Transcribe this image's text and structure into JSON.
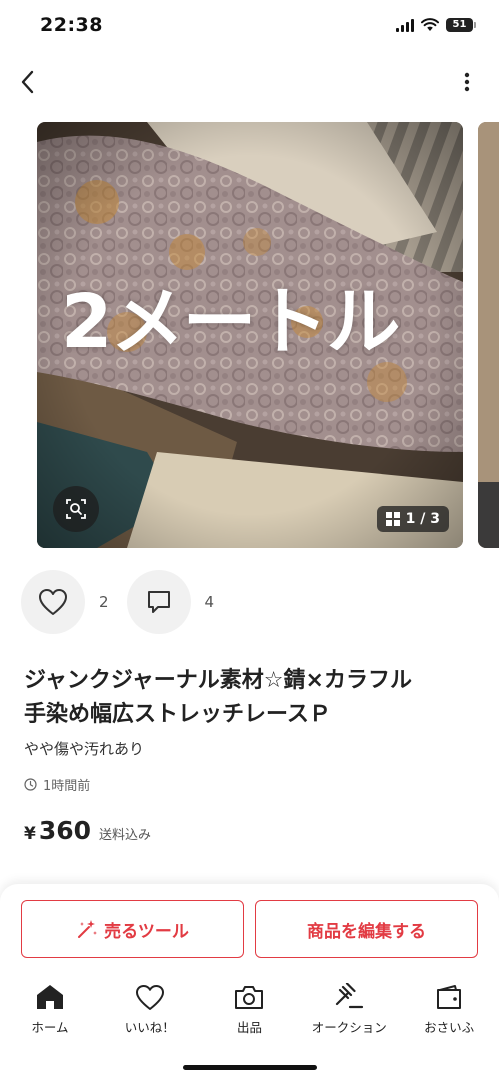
{
  "status_bar": {
    "time": "22:38",
    "battery": "51"
  },
  "carousel": {
    "overlay_text": "2メートル",
    "counter": "1 / 3"
  },
  "actions": {
    "likes": "2",
    "comments": "4"
  },
  "item": {
    "title_line1": "ジャンクジャーナル素材☆錆×カラフル",
    "title_line2": "手染め幅広ストレッチレースＰ",
    "condition": "やや傷や汚れあり",
    "posted": "1時間前",
    "price_symbol": "¥",
    "price": "360",
    "shipping": "送料込み"
  },
  "buttons": {
    "sell_tool": "売るツール",
    "edit_item": "商品を編集する"
  },
  "tabs": [
    {
      "label": "ホーム",
      "icon": "home-icon"
    },
    {
      "label": "いいね！",
      "icon": "heart-icon"
    },
    {
      "label": "出品",
      "icon": "camera-icon"
    },
    {
      "label": "オークション",
      "icon": "gavel-icon"
    },
    {
      "label": "おさいふ",
      "icon": "wallet-icon"
    }
  ],
  "colors": {
    "accent": "#e23b43",
    "text": "#222222"
  }
}
